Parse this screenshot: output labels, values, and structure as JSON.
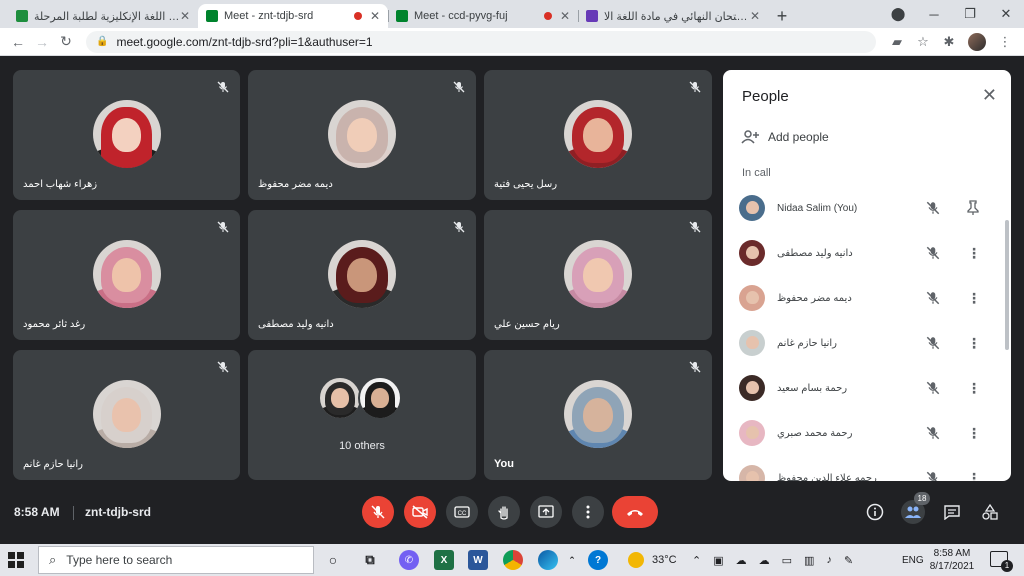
{
  "browser": {
    "tabs": [
      {
        "title": "مادة اللغة الإنكليزية لطلبة المرحلة",
        "favicon_color": "#1e8e3e",
        "active": false,
        "recording": false
      },
      {
        "title": "Meet - znt-tdjb-srd",
        "favicon_color": "#00832d",
        "active": true,
        "recording": true
      },
      {
        "title": "Meet - ccd-pyvg-fuj",
        "favicon_color": "#00832d",
        "active": false,
        "recording": true
      },
      {
        "title": "الامتحان النهائي في مادة اللغة الا",
        "favicon_color": "#673ab7",
        "active": false,
        "recording": false
      }
    ],
    "new_tab": "+",
    "url": "meet.google.com/znt-tdjb-srd?pli=1&authuser=1"
  },
  "meet": {
    "tiles": [
      {
        "name": "زهراء شهاب احمد",
        "hair": "#c0232b",
        "skin": "#f3d1c0",
        "cloth": "#1f1f1f",
        "hijab": false
      },
      {
        "name": "ديمه مضر محفوظ",
        "hair": "#c9b3ad",
        "skin": "#f0cdb8",
        "cloth": "#ded0cc",
        "hijab": true
      },
      {
        "name": "رسل يحيى فتية",
        "hair": "#b3262b",
        "skin": "#e8b49a",
        "cloth": "#8f1f24",
        "hijab": true
      },
      {
        "name": "رغد ثائر محمود",
        "hair": "#d98ea0",
        "skin": "#eec3aa",
        "cloth": "#c96f86",
        "hijab": true
      },
      {
        "name": "دانيه وليد مصطفى",
        "hair": "#5a1c1c",
        "skin": "#c9967a",
        "cloth": "#2a2a2a",
        "hijab": true
      },
      {
        "name": "ريام حسين علي",
        "hair": "#d8a0b8",
        "skin": "#f0c8b0",
        "cloth": "#c68aa3",
        "hijab": true
      },
      {
        "name": "رانيا حازم غانم",
        "hair": "#d7d0cc",
        "skin": "#e9c2ad",
        "cloth": "#b8aca5",
        "hijab": true
      },
      {
        "name": "",
        "others_label": "10 others"
      },
      {
        "name": "You",
        "hair": "#8fa4b7",
        "skin": "#d6b39c",
        "cloth": "#5f86b0",
        "hijab": true
      }
    ],
    "time": "8:58 AM",
    "meeting_code": "znt-tdjb-srd",
    "participant_count": "18"
  },
  "people_panel": {
    "title": "People",
    "add_people": "Add people",
    "in_call": "In call",
    "participants": [
      {
        "name": "Nidaa Salim (You)",
        "color": "#4a6d8c",
        "pinnable": true
      },
      {
        "name": "دانيه وليد مصطفى",
        "color": "#6b2b2b"
      },
      {
        "name": "ديمه مضر محفوظ",
        "color": "#d9a391"
      },
      {
        "name": "رانيا حازم غانم",
        "color": "#c8cfcf"
      },
      {
        "name": "رحمة بسام سعيد",
        "color": "#3b2a26"
      },
      {
        "name": "رحمة محمد صبري",
        "color": "#e7b7c2"
      },
      {
        "name": "رحمه علاء الدين محفوظ",
        "color": "#d6b6a8"
      }
    ]
  },
  "taskbar": {
    "search_placeholder": "Type here to search",
    "temperature": "33°C",
    "language": "ENG",
    "time": "8:58 AM",
    "date": "8/17/2021",
    "notification_count": "1"
  }
}
